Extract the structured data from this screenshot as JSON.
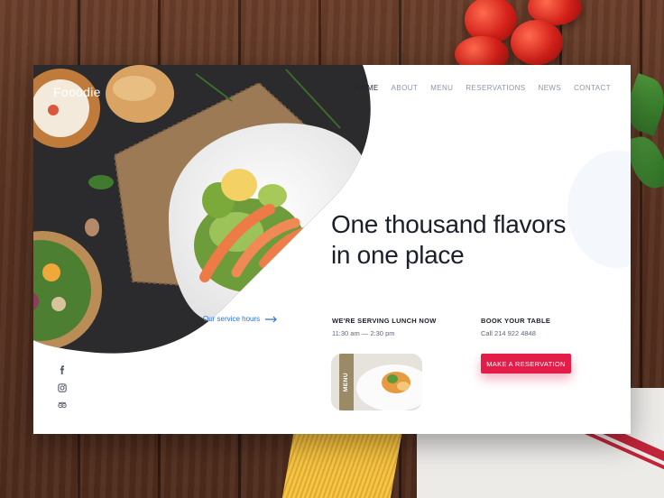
{
  "brand": {
    "logo": "Fooodie"
  },
  "nav": {
    "items": [
      {
        "label": "HOME",
        "active": true
      },
      {
        "label": "ABOUT",
        "active": false
      },
      {
        "label": "MENU",
        "active": false
      },
      {
        "label": "RESERVATIONS",
        "active": false
      },
      {
        "label": "NEWS",
        "active": false
      },
      {
        "label": "CONTACT",
        "active": false
      }
    ]
  },
  "hero": {
    "headline_line1": "One thousand flavors",
    "headline_line2": "in one place"
  },
  "service": {
    "link_label": "Our service hours",
    "icon": "arrow-right-icon"
  },
  "lunch": {
    "title": "WE'RE SERVING LUNCH NOW",
    "hours": "11:30 am — 2:30 pm"
  },
  "booking": {
    "title": "BOOK YOUR TABLE",
    "phone": "Call 214 922 4848",
    "button_label": "MAKE A RESERVATION"
  },
  "menu_card": {
    "tab_label": "MENU"
  },
  "social": {
    "icons": [
      "facebook-icon",
      "instagram-icon",
      "tripadvisor-icon"
    ]
  },
  "colors": {
    "accent": "#e31d47",
    "link": "#2a74d6",
    "nav_active": "#1e2535",
    "nav_inactive": "#8a95aa",
    "text_dark": "#1b1f2a"
  }
}
